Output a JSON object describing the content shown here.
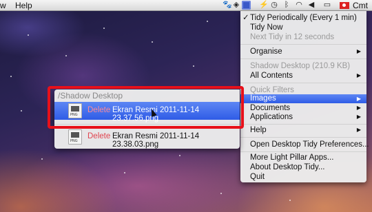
{
  "menubar": {
    "left_partial": "w",
    "help": "Help",
    "user": "Cmt"
  },
  "main_menu": {
    "items": [
      {
        "label": "Tidy Periodically (Every 1 min)",
        "checked": true
      },
      {
        "label": "Tidy Now"
      },
      {
        "label": "Next Tidy in 12 seconds",
        "disabled": true
      },
      {
        "label": "Organise",
        "submenu": true
      },
      {
        "label": "Shadow Desktop (210.9 KB)",
        "disabled": true
      },
      {
        "label": "All Contents",
        "submenu": true
      },
      {
        "label": "Quick Filters",
        "disabled": true
      },
      {
        "label": "Images",
        "submenu": true,
        "selected": true
      },
      {
        "label": "Documents",
        "submenu": true
      },
      {
        "label": "Applications",
        "submenu": true
      },
      {
        "label": "Help",
        "submenu": true
      },
      {
        "label": "Open Desktop Tidy Preferences..."
      },
      {
        "label": "More Light Pillar Apps..."
      },
      {
        "label": "About Desktop Tidy..."
      },
      {
        "label": "Quit"
      }
    ],
    "check_mark": "✓",
    "arrow": "▶"
  },
  "submenu": {
    "header": "/Shadow Desktop",
    "files": [
      {
        "action": "Delete",
        "name": "Ekran Resmi 2011-11-14 23.37.56.png",
        "ext": "PNG",
        "selected": true
      },
      {
        "action": "Delete",
        "name": "Ekran Resmi 2011-11-14 23.38.03.png",
        "ext": "PNG"
      }
    ]
  }
}
